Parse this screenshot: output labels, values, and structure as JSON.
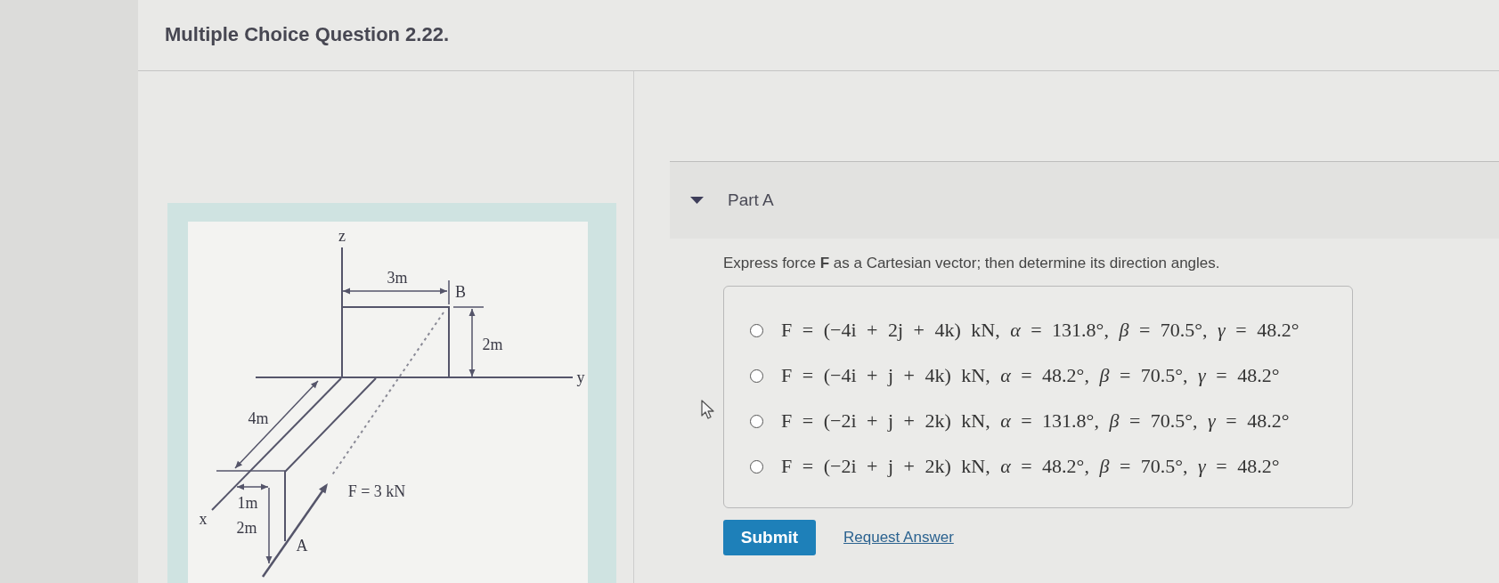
{
  "header": {
    "title": "Multiple Choice Question 2.22."
  },
  "figure": {
    "z_axis_label": "z",
    "width_dimension": "3m",
    "point_b_label": "B",
    "height_dimension": "2m",
    "y_axis_label": "y",
    "length_dimension": "4m",
    "x_axis_label": "x",
    "offset_dimension": "1m",
    "drop_dimension": "2m",
    "point_a_label": "A",
    "force_label": "F = 3 kN"
  },
  "part": {
    "title": "Part A",
    "expanded": true,
    "prompt": "Express force **F** as a Cartesian vector; then determine its direction angles.",
    "options": [
      {
        "text": "F = (−4i + 2j + 4k) kN, *α* = 131.8°, *β* = 70.5°, *γ* = 48.2°",
        "selected": false
      },
      {
        "text": "F = (−4i + j + 4k) kN, *α* = 48.2°, *β* = 70.5°, *γ* = 48.2°",
        "selected": false
      },
      {
        "text": "F = (−2i + j + 2k) kN, *α* = 131.8°, *β* = 70.5°, *γ* = 48.2°",
        "selected": false
      },
      {
        "text": "F = (−2i + j + 2k) kN, *α* = 48.2°, *β* = 70.5°, *γ* = 48.2°",
        "selected": false
      }
    ],
    "buttons": {
      "submit": "Submit",
      "request_answer": "Request Answer"
    }
  }
}
